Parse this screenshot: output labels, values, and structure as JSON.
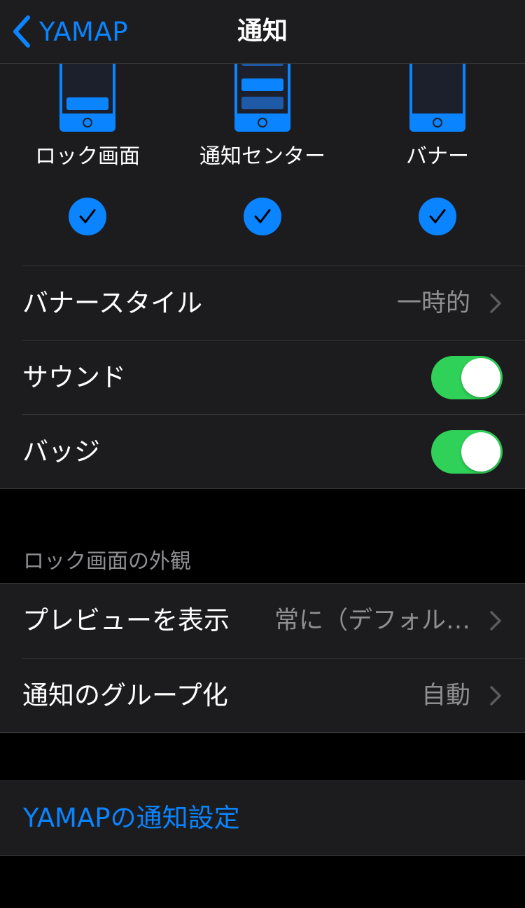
{
  "nav": {
    "back_label": "YAMAP",
    "title": "通知"
  },
  "alerts": {
    "items": [
      {
        "label": "ロック画面",
        "checked": true
      },
      {
        "label": "通知センター",
        "checked": true
      },
      {
        "label": "バナー",
        "checked": true
      }
    ]
  },
  "settings": {
    "banner_style": {
      "label": "バナースタイル",
      "value": "一時的"
    },
    "sounds": {
      "label": "サウンド",
      "on": true
    },
    "badges": {
      "label": "バッジ",
      "on": true
    }
  },
  "lock_screen_section": {
    "header": "ロック画面の外観",
    "show_previews": {
      "label": "プレビューを表示",
      "value": "常に（デフォル…"
    },
    "grouping": {
      "label": "通知のグループ化",
      "value": "自動"
    }
  },
  "app_settings_link": "YAMAPの通知設定",
  "colors": {
    "accent": "#0a84ff",
    "toggle_on": "#30d158",
    "row_bg": "#1c1c1e",
    "background": "#000000",
    "secondary_text": "#8e8e93"
  }
}
